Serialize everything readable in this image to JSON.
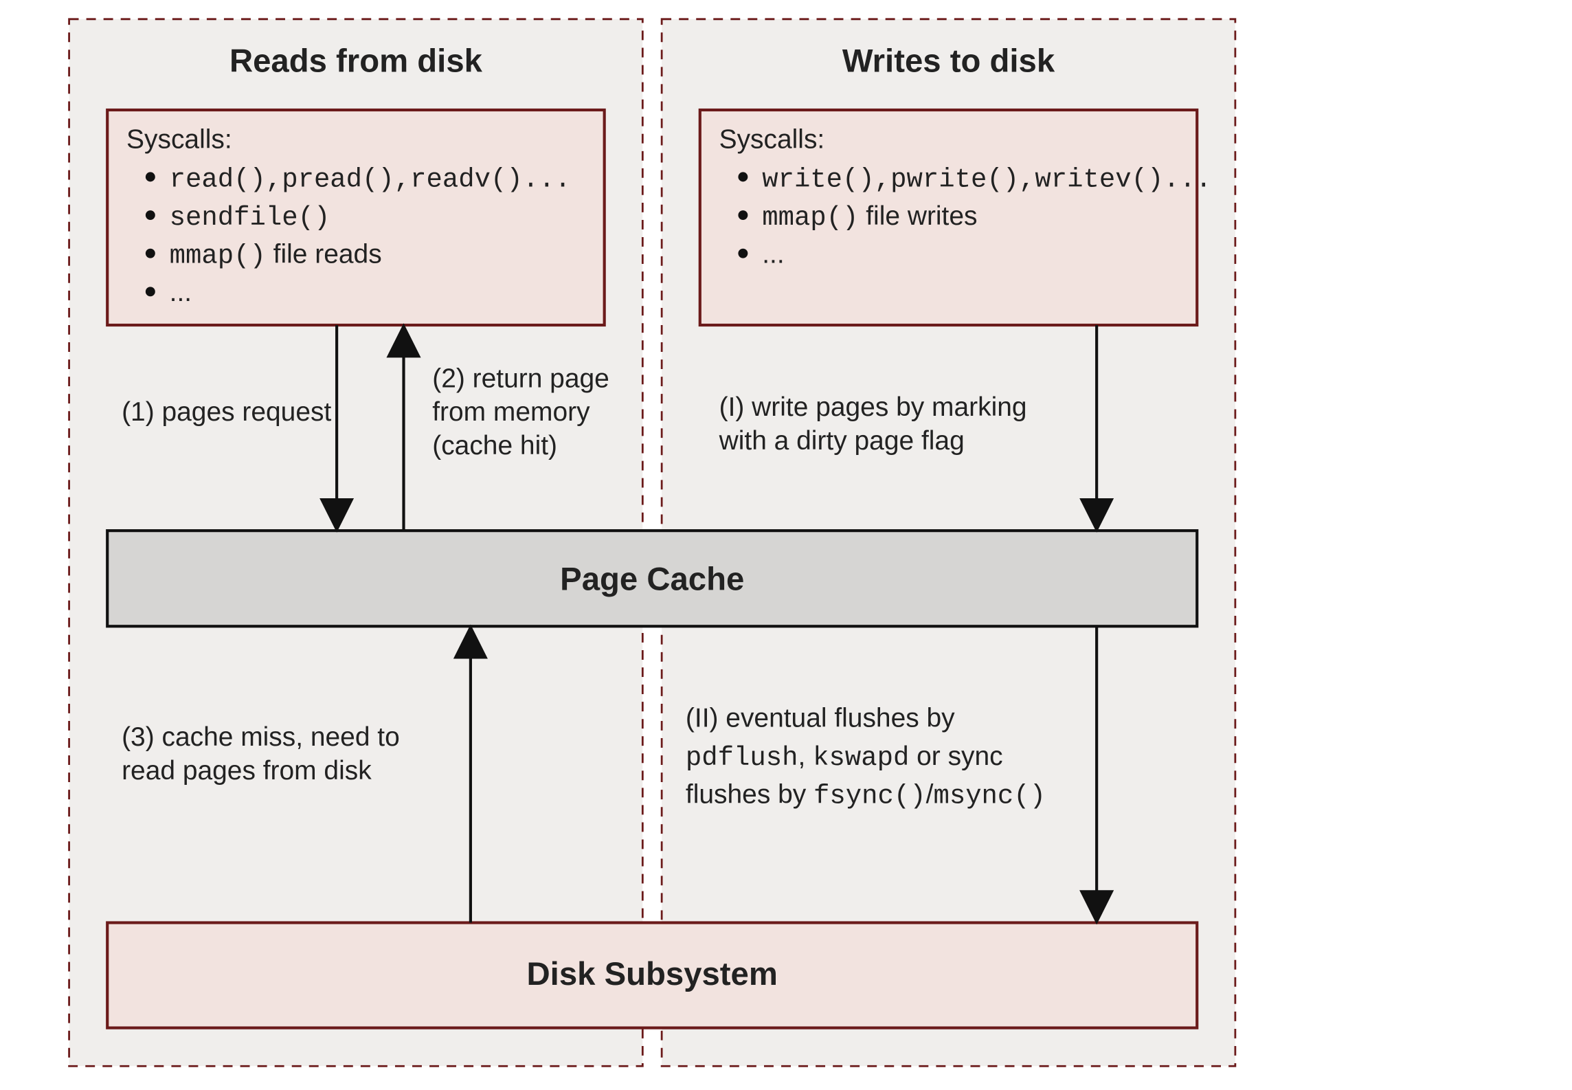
{
  "reads": {
    "title": "Reads from disk",
    "syscalls_label": "Syscalls:",
    "bullet1_code": "read(),pread(),readv()...",
    "bullet2_code": "sendfile()",
    "bullet3_code": "mmap()",
    "bullet3_text": " file reads",
    "bullet4": "...",
    "step1": "(1) pages request",
    "step2_line1": "(2) return page",
    "step2_line2": "from memory",
    "step2_line3": "(cache hit)",
    "step3_line1": "(3) cache miss, need to",
    "step3_line2": "read pages from disk"
  },
  "writes": {
    "title": "Writes to disk",
    "syscalls_label": "Syscalls:",
    "bullet1_code": "write(),pwrite(),writev()...",
    "bullet2_code": "mmap()",
    "bullet2_text": " file writes",
    "bullet3": "...",
    "stepI_line1": "(I) write pages by marking",
    "stepI_line2": "with a dirty page flag",
    "stepII_line1_txt": "(II) eventual flushes by",
    "stepII_line2_code1": "pdflush",
    "stepII_line2_mid": ", ",
    "stepII_line2_code2": "kswapd",
    "stepII_line2_tail": " or sync",
    "stepII_line3_pre": "flushes by ",
    "stepII_line3_code1": "fsync()",
    "stepII_line3_mid": "/",
    "stepII_line3_code2": "msync()"
  },
  "page_cache": "Page Cache",
  "disk_subsystem": "Disk Subsystem",
  "colors": {
    "panel_bg": "#f0eeec",
    "panel_stroke": "#6b1a1a",
    "box_bg": "#f2e3df",
    "box_stroke": "#6b1a1a",
    "cache_bg": "#d6d5d3",
    "cache_stroke": "#111"
  }
}
